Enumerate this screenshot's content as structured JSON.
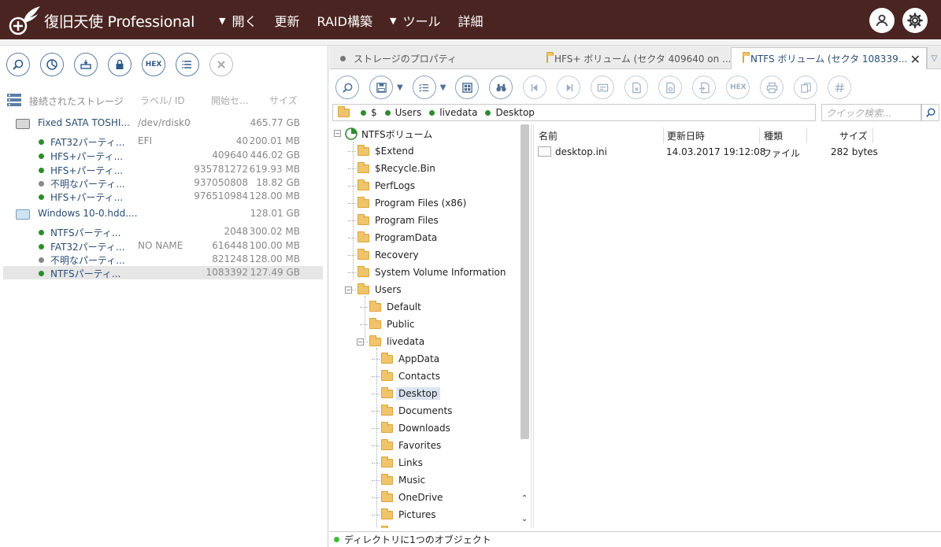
{
  "app": {
    "title": "復旧天使 Professional"
  },
  "menu": [
    {
      "label": "開く",
      "caret": true
    },
    {
      "label": "更新",
      "caret": false
    },
    {
      "label": "RAID構築",
      "caret": false
    },
    {
      "label": "ツール",
      "caret": true
    },
    {
      "label": "詳細",
      "caret": false
    }
  ],
  "left_toolbar": {
    "hex_label": "HEX"
  },
  "storage": {
    "header": {
      "title": "接続されたストレージ",
      "label_col": "ラベル/ ID",
      "start_col": "開始セ...",
      "size_col": "サイズ"
    },
    "rows": [
      {
        "type": "disk",
        "name": "Fixed SATA TOSHI...",
        "label": "/dev/rdisk0",
        "start": "",
        "size": "465.77 GB",
        "icon": "hdd-icon",
        "selected": false
      },
      {
        "type": "part",
        "name": "FAT32パーティ...",
        "label": "EFI",
        "start": "40",
        "size": "200.01 MB",
        "status": "green",
        "selected": false
      },
      {
        "type": "part",
        "name": "HFS+パーティ...",
        "label": "",
        "start": "409640",
        "size": "446.02 GB",
        "status": "green",
        "selected": false
      },
      {
        "type": "part",
        "name": "HFS+パーティ...",
        "label": "",
        "start": "935781272",
        "size": "619.93 MB",
        "status": "green",
        "selected": false
      },
      {
        "type": "part",
        "name": "不明なパーティ...",
        "label": "",
        "start": "937050808",
        "size": "18.82 GB",
        "status": "grey",
        "selected": false
      },
      {
        "type": "part",
        "name": "HFS+パーティ...",
        "label": "",
        "start": "976510984",
        "size": "128.00 MB",
        "status": "green",
        "selected": false
      },
      {
        "type": "disk",
        "name": "Windows 10-0.hdd....",
        "label": "",
        "start": "",
        "size": "128.01 GB",
        "icon": "virtual-disk-icon",
        "selected": false
      },
      {
        "type": "part",
        "name": "NTFSパーティ...",
        "label": "",
        "start": "2048",
        "size": "300.02 MB",
        "status": "green",
        "selected": false
      },
      {
        "type": "part",
        "name": "FAT32パーティ...",
        "label": "NO NAME",
        "start": "616448",
        "size": "100.00 MB",
        "status": "green",
        "selected": false
      },
      {
        "type": "part",
        "name": "不明なパーティ...",
        "label": "",
        "start": "821248",
        "size": "128.00 MB",
        "status": "grey",
        "selected": false
      },
      {
        "type": "part",
        "name": "NTFSパーティ...",
        "label": "",
        "start": "1083392",
        "size": "127.49 GB",
        "status": "green",
        "selected": true
      }
    ]
  },
  "tabs": [
    {
      "label": "ストレージのプロパティ",
      "icon": "dot"
    },
    {
      "label": "HFS+ ボリューム (セクタ 409640 on ...",
      "icon": "folder"
    },
    {
      "label": "NTFS ボリューム (セクタ 108339...",
      "icon": "folder",
      "active": true
    }
  ],
  "right_toolbar": {
    "hex_label": "HEX"
  },
  "path": {
    "segments": [
      "$",
      "Users",
      "livedata",
      "Desktop"
    ]
  },
  "search": {
    "placeholder": "クイック検索..."
  },
  "tree": {
    "root": "NTFSボリューム",
    "items": [
      {
        "label": "$Extend",
        "level": 1
      },
      {
        "label": "$Recycle.Bin",
        "level": 1
      },
      {
        "label": "PerfLogs",
        "level": 1
      },
      {
        "label": "Program Files (x86)",
        "level": 1
      },
      {
        "label": "Program Files",
        "level": 1
      },
      {
        "label": "ProgramData",
        "level": 1
      },
      {
        "label": "Recovery",
        "level": 1
      },
      {
        "label": "System Volume Information",
        "level": 1
      },
      {
        "label": "Users",
        "level": 1,
        "expanded": true
      },
      {
        "label": "Default",
        "level": 2
      },
      {
        "label": "Public",
        "level": 2
      },
      {
        "label": "livedata",
        "level": 2,
        "expanded": true
      },
      {
        "label": "AppData",
        "level": 3
      },
      {
        "label": "Contacts",
        "level": 3
      },
      {
        "label": "Desktop",
        "level": 3,
        "selected": true
      },
      {
        "label": "Documents",
        "level": 3
      },
      {
        "label": "Downloads",
        "level": 3
      },
      {
        "label": "Favorites",
        "level": 3
      },
      {
        "label": "Links",
        "level": 3
      },
      {
        "label": "Music",
        "level": 3
      },
      {
        "label": "OneDrive",
        "level": 3
      },
      {
        "label": "Pictures",
        "level": 3
      }
    ]
  },
  "files": {
    "columns": {
      "name": "名前",
      "modified": "更新日時",
      "type": "種類",
      "size": "サイズ"
    },
    "rows": [
      {
        "name": "desktop.ini",
        "modified": "14.03.2017 19:12:08",
        "type": "ファイル",
        "size": "282 bytes"
      }
    ]
  },
  "status": {
    "text": "ディレクトリに1つのオブジェクト"
  },
  "colors": {
    "topbar": "#4a2420",
    "accent": "#2a4d73",
    "status_green": "#2e8b2e"
  }
}
